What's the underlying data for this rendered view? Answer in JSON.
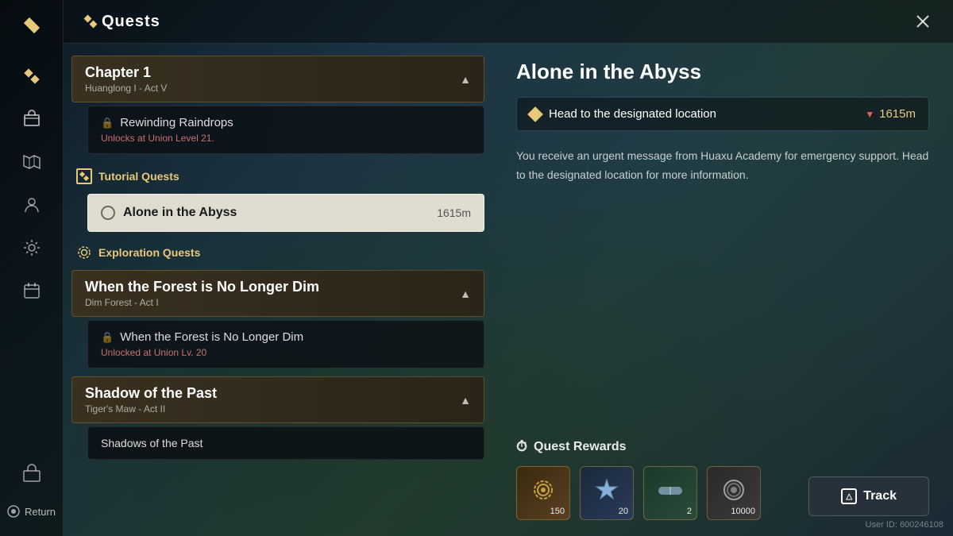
{
  "header": {
    "title": "Quests",
    "close_icon": "✕"
  },
  "sidebar": {
    "icons": [
      "◆",
      "🛡",
      "🗺",
      "👤",
      "⚙",
      "📋"
    ],
    "bottom": {
      "return_label": "Return"
    }
  },
  "quest_list": {
    "chapter_group": {
      "title": "Chapter 1",
      "subtitle": "Huanglong I - Act V",
      "quests": [
        {
          "name": "Rewinding Raindrops",
          "unlock_text": "Unlocks at Union Level 21.",
          "locked": true
        }
      ]
    },
    "tutorial_section": {
      "label": "Tutorial Quests",
      "quests": [
        {
          "name": "Alone in the Abyss",
          "distance": "1615m",
          "active": true
        }
      ]
    },
    "exploration_section": {
      "label": "Exploration Quests",
      "chapter_group": {
        "title": "When the Forest is No Longer Dim",
        "subtitle": "Dim Forest - Act I",
        "quests": [
          {
            "name": "When the Forest is No Longer Dim",
            "unlock_text": "Unlocked at Union Lv. 20",
            "locked": true
          }
        ]
      },
      "chapter_group2": {
        "title": "Shadow of the Past",
        "subtitle": "Tiger's Maw - Act II",
        "quests": [
          {
            "name": "Shadows of the Past",
            "locked": false,
            "partial": true
          }
        ]
      }
    }
  },
  "quest_detail": {
    "title": "Alone in the Abyss",
    "objective": {
      "text": "Head to the designated location",
      "distance": "1615m",
      "direction": "▼"
    },
    "description": "You receive an urgent message from Huaxu Academy for emergency support. Head to the designated location for more information.",
    "rewards": {
      "title": "Quest Rewards",
      "items": [
        {
          "icon": "⚙",
          "count": "150",
          "type": "gear"
        },
        {
          "icon": "✦",
          "count": "20",
          "type": "star"
        },
        {
          "icon": "💊",
          "count": "2",
          "type": "pill"
        },
        {
          "icon": "◎",
          "count": "10000",
          "type": "coin"
        }
      ]
    }
  },
  "track_button": {
    "label": "Track",
    "icon": "△"
  },
  "footer": {
    "user_id": "User ID: 600246108"
  },
  "colors": {
    "accent_gold": "#e8c87a",
    "locked_red": "#c87070",
    "bg_dark": "#0d1a22",
    "active_item_bg": "#f0ebe0"
  }
}
